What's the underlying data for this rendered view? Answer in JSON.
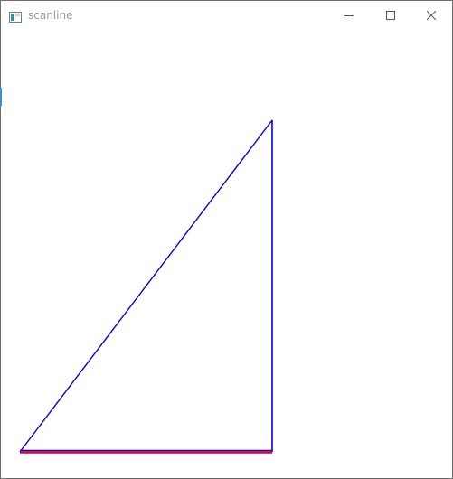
{
  "window": {
    "title": "scanline"
  },
  "icons": {
    "app": "app-window-icon",
    "minimize": "minimize-icon",
    "maximize": "maximize-icon",
    "close": "close-icon"
  },
  "colors": {
    "edge": "#0000dd",
    "scanline": "#dd0033",
    "title_text": "#9a9a9a"
  }
}
